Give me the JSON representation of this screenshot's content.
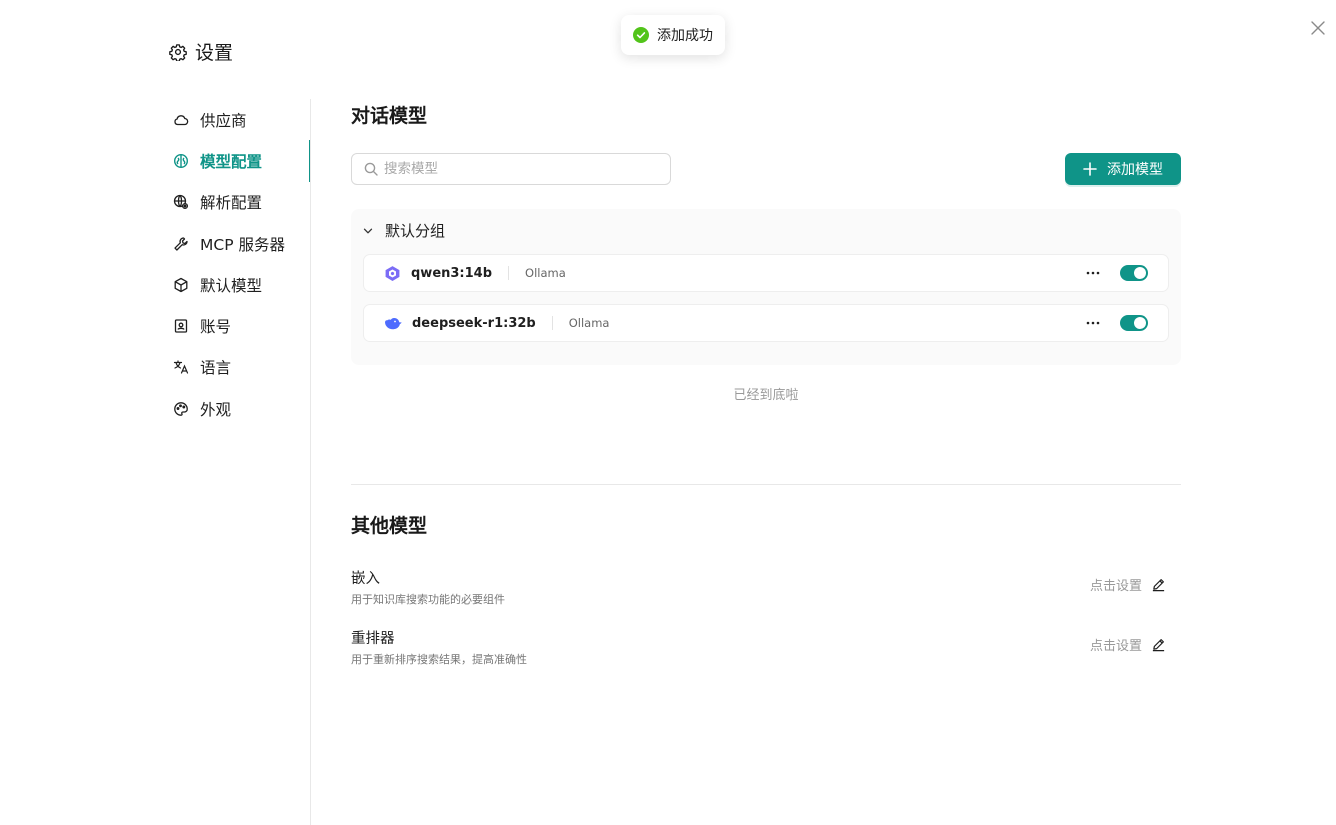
{
  "toast": {
    "text": "添加成功",
    "icon": "check-circle-icon",
    "color": "#52c41a"
  },
  "page": {
    "title": "设置",
    "title_icon": "gear-icon"
  },
  "accent_color": "#0f9488",
  "sidebar": {
    "items": [
      {
        "label": "供应商",
        "icon": "cloud-icon",
        "active": false
      },
      {
        "label": "模型配置",
        "icon": "brain-icon",
        "active": true
      },
      {
        "label": "解析配置",
        "icon": "globe-gear-icon",
        "active": false
      },
      {
        "label": "MCP 服务器",
        "icon": "wrench-icon",
        "active": false
      },
      {
        "label": "默认模型",
        "icon": "cube-icon",
        "active": false
      },
      {
        "label": "账号",
        "icon": "id-card-icon",
        "active": false
      },
      {
        "label": "语言",
        "icon": "translate-icon",
        "active": false
      },
      {
        "label": "外观",
        "icon": "palette-icon",
        "active": false
      }
    ]
  },
  "chat_models": {
    "title": "对话模型",
    "search_placeholder": "搜索模型",
    "add_button": "添加模型",
    "group": {
      "name": "默认分组",
      "expanded": true,
      "models": [
        {
          "name": "qwen3:14b",
          "provider": "Ollama",
          "icon": "qwen-logo-icon",
          "enabled": true
        },
        {
          "name": "deepseek-r1:32b",
          "provider": "Ollama",
          "icon": "deepseek-logo-icon",
          "enabled": true
        }
      ]
    },
    "end_text": "已经到底啦"
  },
  "other_models": {
    "title": "其他模型",
    "items": [
      {
        "name": "嵌入",
        "desc": "用于知识库搜索功能的必要组件",
        "action": "点击设置"
      },
      {
        "name": "重排器",
        "desc": "用于重新排序搜索结果，提高准确性",
        "action": "点击设置"
      }
    ]
  }
}
